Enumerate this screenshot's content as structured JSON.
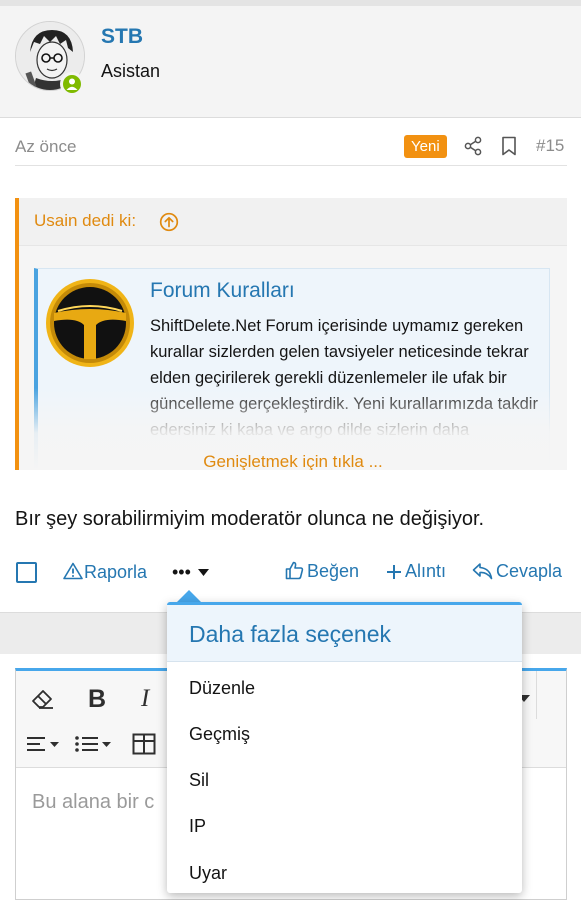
{
  "post": {
    "username": "STB",
    "user_title": "Asistan",
    "time": "Az önce",
    "new_badge": "Yeni",
    "number": "#15",
    "body": "Bır şey sorabilirmiyim moderatör olunca ne değişiyor."
  },
  "quote": {
    "author": "Usain dedi ki:",
    "embed_title": "Forum Kuralları",
    "embed_text": "ShiftDelete.Net Forum içerisinde uymamız gereken kurallar sizlerden gelen tavsiyeler neticesinde tekrar elden geçirilerek gerekli düzenlemeler ile ufak bir güncelleme gerçekleştirdik. Yeni kurallarımızda takdir edersiniz ki kaba ve argo dilde sizlerin daha",
    "expand_label": "Genişletmek için tıkla ..."
  },
  "actions": {
    "report": "Raporla",
    "more": "•••",
    "like": "Beğen",
    "quote": "Alıntı",
    "reply": "Cevapla"
  },
  "editor": {
    "placeholder": "Bu alana bir c"
  },
  "menu": {
    "title": "Daha fazla seçenek",
    "items": [
      "Düzenle",
      "Geçmiş",
      "Sil",
      "IP",
      "Uyar"
    ]
  },
  "colors": {
    "link_blue": "#2577b1",
    "accent_orange": "#f29111",
    "online_green": "#7fba00",
    "editor_border": "#47a7eb"
  }
}
